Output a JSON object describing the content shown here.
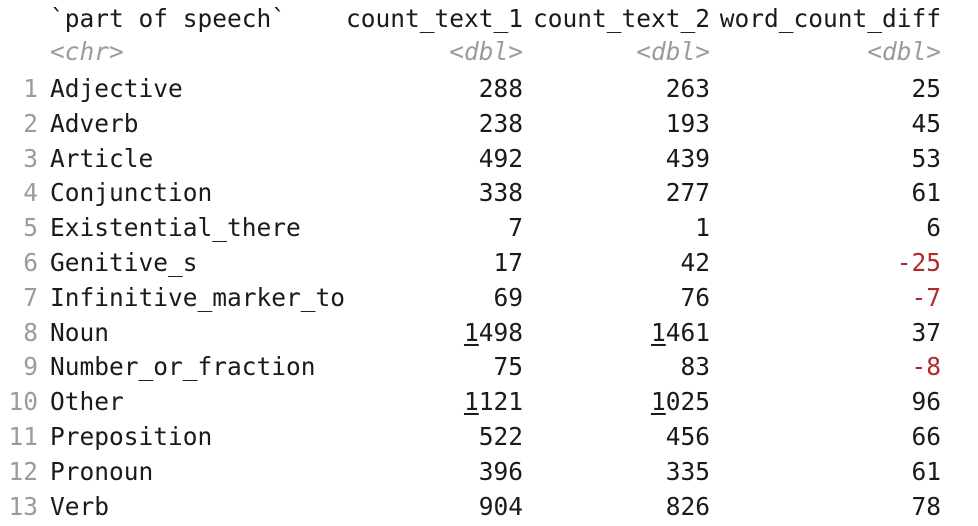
{
  "columns": {
    "pos": "`part of speech`",
    "c1": "count_text_1",
    "c2": "count_text_2",
    "c3": "word_count_diff"
  },
  "types": {
    "pos": "<chr>",
    "c1": "<dbl>",
    "c2": "<dbl>",
    "c3": "<dbl>"
  },
  "rows": [
    {
      "idx": "1",
      "pos": "Adjective",
      "c1_hi": "",
      "c1": "288",
      "c2_hi": "",
      "c2": "263",
      "c3_sign": "",
      "c3": "25"
    },
    {
      "idx": "2",
      "pos": "Adverb",
      "c1_hi": "",
      "c1": "238",
      "c2_hi": "",
      "c2": "193",
      "c3_sign": "",
      "c3": "45"
    },
    {
      "idx": "3",
      "pos": "Article",
      "c1_hi": "",
      "c1": "492",
      "c2_hi": "",
      "c2": "439",
      "c3_sign": "",
      "c3": "53"
    },
    {
      "idx": "4",
      "pos": "Conjunction",
      "c1_hi": "",
      "c1": "338",
      "c2_hi": "",
      "c2": "277",
      "c3_sign": "",
      "c3": "61"
    },
    {
      "idx": "5",
      "pos": "Existential_there",
      "c1_hi": "",
      "c1": "7",
      "c2_hi": "",
      "c2": "1",
      "c3_sign": "",
      "c3": "6"
    },
    {
      "idx": "6",
      "pos": "Genitive_s",
      "c1_hi": "",
      "c1": "17",
      "c2_hi": "",
      "c2": "42",
      "c3_sign": "-",
      "c3": "25"
    },
    {
      "idx": "7",
      "pos": "Infinitive_marker_to",
      "c1_hi": "",
      "c1": "69",
      "c2_hi": "",
      "c2": "76",
      "c3_sign": "-",
      "c3": "7"
    },
    {
      "idx": "8",
      "pos": "Noun",
      "c1_hi": "1",
      "c1": "498",
      "c2_hi": "1",
      "c2": "461",
      "c3_sign": "",
      "c3": "37"
    },
    {
      "idx": "9",
      "pos": "Number_or_fraction",
      "c1_hi": "",
      "c1": "75",
      "c2_hi": "",
      "c2": "83",
      "c3_sign": "-",
      "c3": "8"
    },
    {
      "idx": "10",
      "pos": "Other",
      "c1_hi": "1",
      "c1": "121",
      "c2_hi": "1",
      "c2": "025",
      "c3_sign": "",
      "c3": "96"
    },
    {
      "idx": "11",
      "pos": "Preposition",
      "c1_hi": "",
      "c1": "522",
      "c2_hi": "",
      "c2": "456",
      "c3_sign": "",
      "c3": "66"
    },
    {
      "idx": "12",
      "pos": "Pronoun",
      "c1_hi": "",
      "c1": "396",
      "c2_hi": "",
      "c2": "335",
      "c3_sign": "",
      "c3": "61"
    },
    {
      "idx": "13",
      "pos": "Verb",
      "c1_hi": "",
      "c1": "904",
      "c2_hi": "",
      "c2": "826",
      "c3_sign": "",
      "c3": "78"
    }
  ],
  "colors": {
    "text": "#1a1a1a",
    "muted": "#9b9b9b",
    "negative": "#b02a2a"
  }
}
